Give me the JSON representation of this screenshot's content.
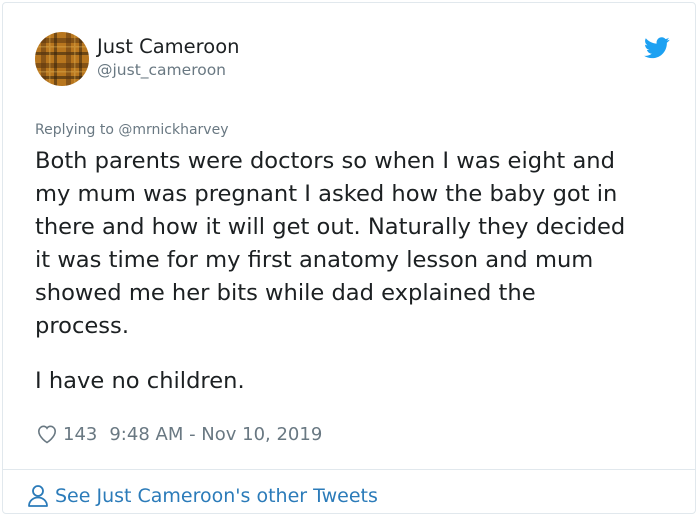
{
  "author": {
    "name": "Just Cameroon",
    "handle": "@just_cameroon"
  },
  "icons": {
    "avatar": "plaid-avatar",
    "brand": "twitter-bird-icon",
    "like": "heart-icon",
    "profile": "person-icon"
  },
  "colors": {
    "brand": "#1da1f2",
    "link": "#2b7bb9",
    "muted": "#697882",
    "text": "#1c2022"
  },
  "tweet": {
    "reply_to": "Replying to @mrnickharvey",
    "paragraphs": [
      "Both parents were doctors so when I was eight and\nmy mum was pregnant I asked how the baby got in\nthere and how it will get out. Naturally they decided\nit was time for my first anatomy lesson and mum\nshowed me her bits while dad explained the\nprocess.",
      "I have no children."
    ],
    "likes": "143",
    "timestamp": "9:48 AM - Nov 10, 2019"
  },
  "footer": {
    "link_label": "See Just Cameroon's other Tweets"
  }
}
